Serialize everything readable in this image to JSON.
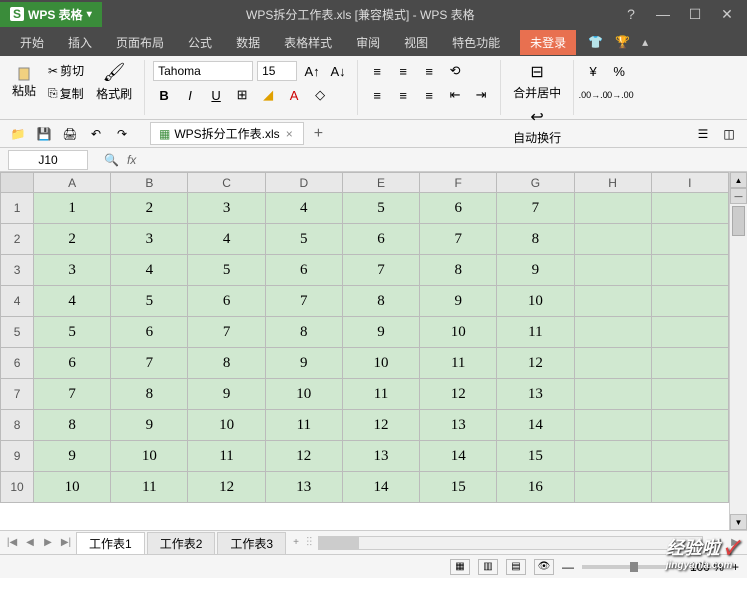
{
  "app": {
    "logo_s": "S",
    "logo_text": "WPS 表格",
    "title": "WPS拆分工作表.xls [兼容模式] - WPS 表格"
  },
  "menubar": {
    "items": [
      "开始",
      "插入",
      "页面布局",
      "公式",
      "数据",
      "表格样式",
      "审阅",
      "视图",
      "特色功能"
    ],
    "login": "未登录"
  },
  "ribbon": {
    "paste": "粘贴",
    "cut": "剪切",
    "copy": "复制",
    "format_painter": "格式刷",
    "font": "Tahoma",
    "size": "15",
    "merge_center": "合并居中",
    "wrap": "自动换行"
  },
  "tab": {
    "filename": "WPS拆分工作表.xls"
  },
  "formula": {
    "cell_ref": "J10",
    "fx": "fx"
  },
  "grid": {
    "columns": [
      "A",
      "B",
      "C",
      "D",
      "E",
      "F",
      "G",
      "H",
      "I"
    ],
    "rows": [
      1,
      2,
      3,
      4,
      5,
      6,
      7,
      8,
      9,
      10
    ],
    "data": [
      [
        1,
        2,
        3,
        4,
        5,
        6,
        7,
        "",
        ""
      ],
      [
        2,
        3,
        4,
        5,
        6,
        7,
        8,
        "",
        ""
      ],
      [
        3,
        4,
        5,
        6,
        7,
        8,
        9,
        "",
        ""
      ],
      [
        4,
        5,
        6,
        7,
        8,
        9,
        10,
        "",
        ""
      ],
      [
        5,
        6,
        7,
        8,
        9,
        10,
        11,
        "",
        ""
      ],
      [
        6,
        7,
        8,
        9,
        10,
        11,
        12,
        "",
        ""
      ],
      [
        7,
        8,
        9,
        10,
        11,
        12,
        13,
        "",
        ""
      ],
      [
        8,
        9,
        10,
        11,
        12,
        13,
        14,
        "",
        ""
      ],
      [
        9,
        10,
        11,
        12,
        13,
        14,
        15,
        "",
        ""
      ],
      [
        10,
        11,
        12,
        13,
        14,
        15,
        16,
        "",
        ""
      ]
    ]
  },
  "sheets": {
    "tabs": [
      "工作表1",
      "工作表2",
      "工作表3"
    ],
    "active": 0
  },
  "status": {
    "zoom": "100 %"
  },
  "watermark": {
    "main": "经验啦",
    "check": "✓",
    "sub": "jingyanla.com"
  }
}
